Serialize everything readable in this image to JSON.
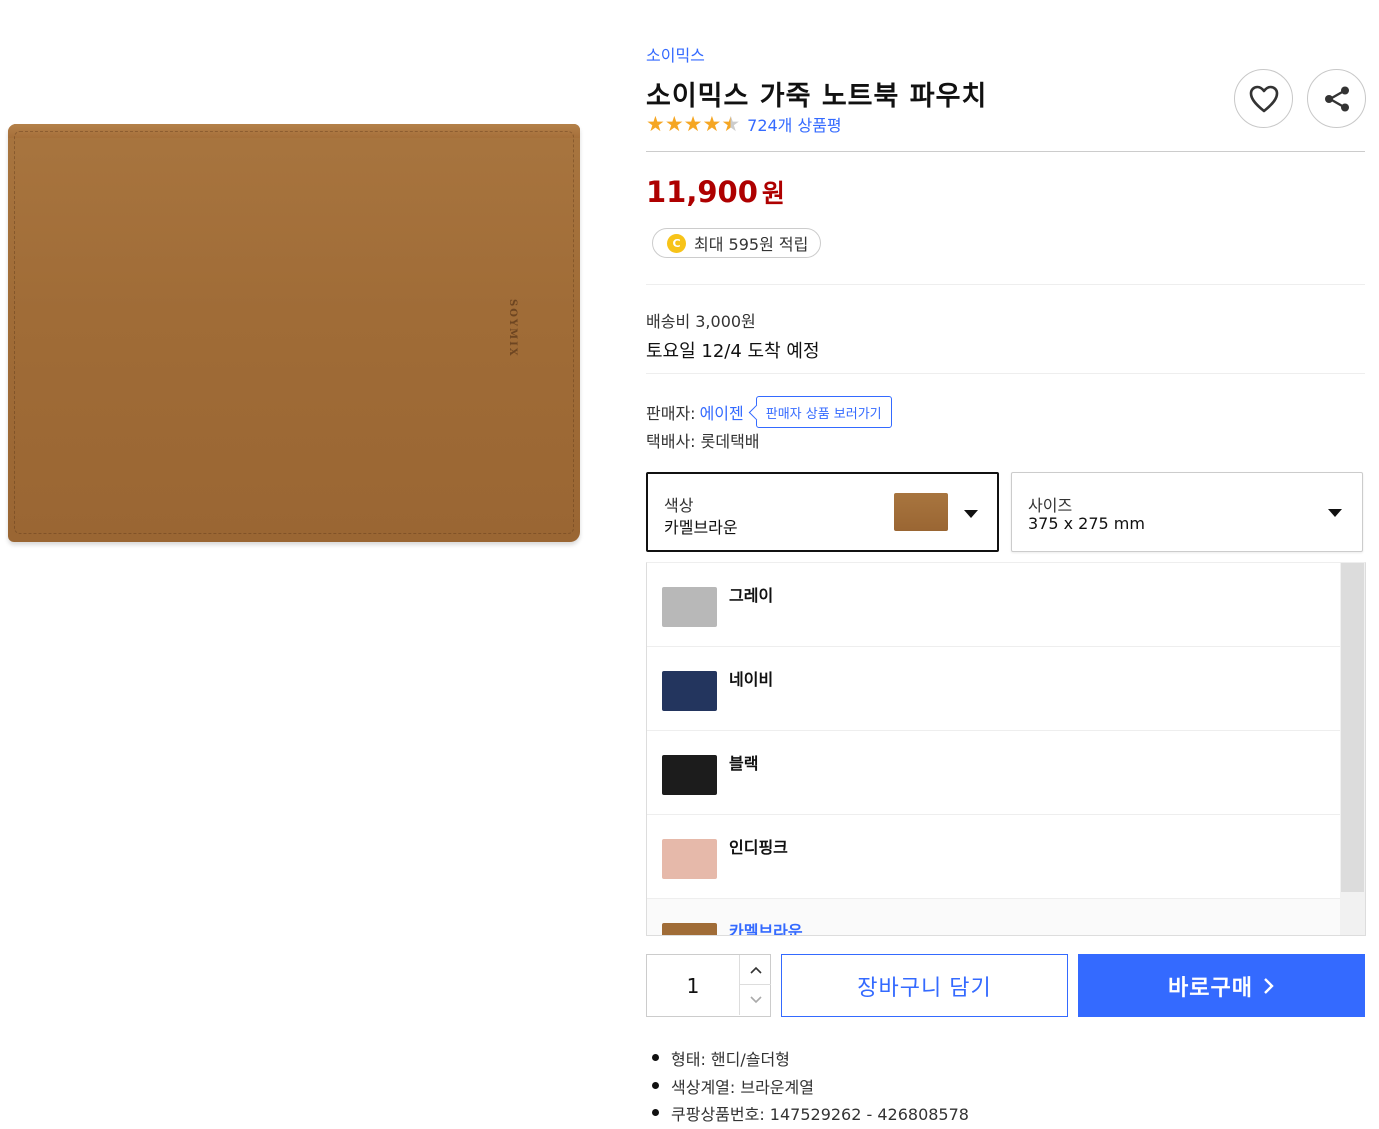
{
  "product": {
    "brand": "소이믹스",
    "title": "소이믹스 가죽 노트북 파우치",
    "rating": 4.5,
    "review_count": "724개 상품평",
    "image_logo_text": "SOYMIX"
  },
  "actions": {
    "wishlist_icon": "heart-icon",
    "share_icon": "share-icon"
  },
  "price": {
    "amount": "11,900",
    "currency": "원"
  },
  "cashback": {
    "coin_letter": "C",
    "text": "최대 595원 적립"
  },
  "shipping": {
    "fee": "배송비 3,000원",
    "arrival": "토요일 12/4 도착 예정"
  },
  "seller": {
    "label": "판매자:",
    "name": "에이젠",
    "link_label": "판매자 상품 보러가기",
    "courier": "택배사: 롯데택배"
  },
  "options": {
    "color": {
      "label": "색상",
      "value": "카멜브라운",
      "swatch_color": "#a06c37"
    },
    "size": {
      "label": "사이즈",
      "value": "375 x 275 mm"
    },
    "color_list": [
      {
        "label": "그레이",
        "color": "#b8b8b8"
      },
      {
        "label": "네이비",
        "color": "#23355e"
      },
      {
        "label": "블랙",
        "color": "#1c1c1c"
      },
      {
        "label": "인디핑크",
        "color": "#e6b9aa"
      },
      {
        "label": "카멜브라운",
        "color": "#a06c37",
        "selected": true
      }
    ]
  },
  "purchase": {
    "quantity": "1",
    "cart_label": "장바구니 담기",
    "buy_label": "바로구매",
    "accent": "#346aff"
  },
  "specs": [
    "형태: 핸디/숄더형",
    "색상계열: 브라운계열",
    "쿠팡상품번호: 147529262 - 426808578"
  ]
}
